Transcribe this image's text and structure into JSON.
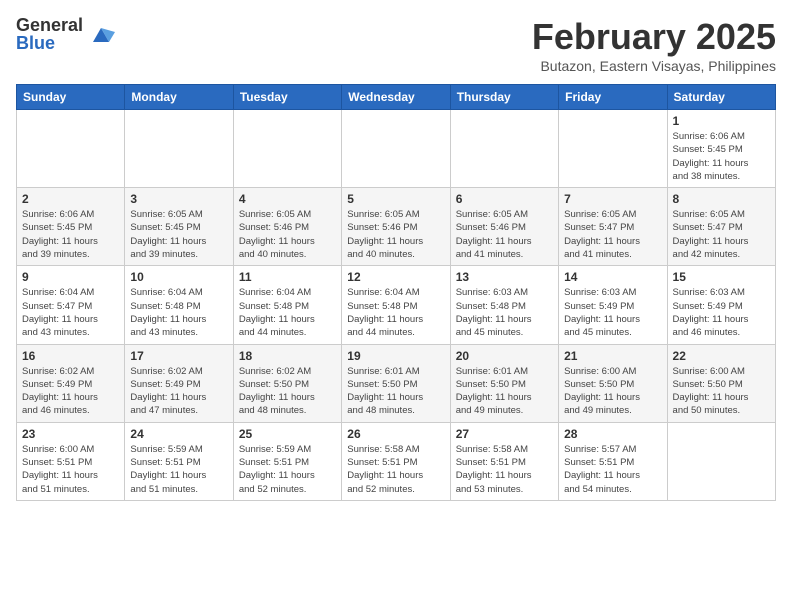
{
  "header": {
    "logo_general": "General",
    "logo_blue": "Blue",
    "month_year": "February 2025",
    "location": "Butazon, Eastern Visayas, Philippines"
  },
  "weekdays": [
    "Sunday",
    "Monday",
    "Tuesday",
    "Wednesday",
    "Thursday",
    "Friday",
    "Saturday"
  ],
  "weeks": [
    [
      {
        "day": "",
        "info": ""
      },
      {
        "day": "",
        "info": ""
      },
      {
        "day": "",
        "info": ""
      },
      {
        "day": "",
        "info": ""
      },
      {
        "day": "",
        "info": ""
      },
      {
        "day": "",
        "info": ""
      },
      {
        "day": "1",
        "info": "Sunrise: 6:06 AM\nSunset: 5:45 PM\nDaylight: 11 hours\nand 38 minutes."
      }
    ],
    [
      {
        "day": "2",
        "info": "Sunrise: 6:06 AM\nSunset: 5:45 PM\nDaylight: 11 hours\nand 39 minutes."
      },
      {
        "day": "3",
        "info": "Sunrise: 6:05 AM\nSunset: 5:45 PM\nDaylight: 11 hours\nand 39 minutes."
      },
      {
        "day": "4",
        "info": "Sunrise: 6:05 AM\nSunset: 5:46 PM\nDaylight: 11 hours\nand 40 minutes."
      },
      {
        "day": "5",
        "info": "Sunrise: 6:05 AM\nSunset: 5:46 PM\nDaylight: 11 hours\nand 40 minutes."
      },
      {
        "day": "6",
        "info": "Sunrise: 6:05 AM\nSunset: 5:46 PM\nDaylight: 11 hours\nand 41 minutes."
      },
      {
        "day": "7",
        "info": "Sunrise: 6:05 AM\nSunset: 5:47 PM\nDaylight: 11 hours\nand 41 minutes."
      },
      {
        "day": "8",
        "info": "Sunrise: 6:05 AM\nSunset: 5:47 PM\nDaylight: 11 hours\nand 42 minutes."
      }
    ],
    [
      {
        "day": "9",
        "info": "Sunrise: 6:04 AM\nSunset: 5:47 PM\nDaylight: 11 hours\nand 43 minutes."
      },
      {
        "day": "10",
        "info": "Sunrise: 6:04 AM\nSunset: 5:48 PM\nDaylight: 11 hours\nand 43 minutes."
      },
      {
        "day": "11",
        "info": "Sunrise: 6:04 AM\nSunset: 5:48 PM\nDaylight: 11 hours\nand 44 minutes."
      },
      {
        "day": "12",
        "info": "Sunrise: 6:04 AM\nSunset: 5:48 PM\nDaylight: 11 hours\nand 44 minutes."
      },
      {
        "day": "13",
        "info": "Sunrise: 6:03 AM\nSunset: 5:48 PM\nDaylight: 11 hours\nand 45 minutes."
      },
      {
        "day": "14",
        "info": "Sunrise: 6:03 AM\nSunset: 5:49 PM\nDaylight: 11 hours\nand 45 minutes."
      },
      {
        "day": "15",
        "info": "Sunrise: 6:03 AM\nSunset: 5:49 PM\nDaylight: 11 hours\nand 46 minutes."
      }
    ],
    [
      {
        "day": "16",
        "info": "Sunrise: 6:02 AM\nSunset: 5:49 PM\nDaylight: 11 hours\nand 46 minutes."
      },
      {
        "day": "17",
        "info": "Sunrise: 6:02 AM\nSunset: 5:49 PM\nDaylight: 11 hours\nand 47 minutes."
      },
      {
        "day": "18",
        "info": "Sunrise: 6:02 AM\nSunset: 5:50 PM\nDaylight: 11 hours\nand 48 minutes."
      },
      {
        "day": "19",
        "info": "Sunrise: 6:01 AM\nSunset: 5:50 PM\nDaylight: 11 hours\nand 48 minutes."
      },
      {
        "day": "20",
        "info": "Sunrise: 6:01 AM\nSunset: 5:50 PM\nDaylight: 11 hours\nand 49 minutes."
      },
      {
        "day": "21",
        "info": "Sunrise: 6:00 AM\nSunset: 5:50 PM\nDaylight: 11 hours\nand 49 minutes."
      },
      {
        "day": "22",
        "info": "Sunrise: 6:00 AM\nSunset: 5:50 PM\nDaylight: 11 hours\nand 50 minutes."
      }
    ],
    [
      {
        "day": "23",
        "info": "Sunrise: 6:00 AM\nSunset: 5:51 PM\nDaylight: 11 hours\nand 51 minutes."
      },
      {
        "day": "24",
        "info": "Sunrise: 5:59 AM\nSunset: 5:51 PM\nDaylight: 11 hours\nand 51 minutes."
      },
      {
        "day": "25",
        "info": "Sunrise: 5:59 AM\nSunset: 5:51 PM\nDaylight: 11 hours\nand 52 minutes."
      },
      {
        "day": "26",
        "info": "Sunrise: 5:58 AM\nSunset: 5:51 PM\nDaylight: 11 hours\nand 52 minutes."
      },
      {
        "day": "27",
        "info": "Sunrise: 5:58 AM\nSunset: 5:51 PM\nDaylight: 11 hours\nand 53 minutes."
      },
      {
        "day": "28",
        "info": "Sunrise: 5:57 AM\nSunset: 5:51 PM\nDaylight: 11 hours\nand 54 minutes."
      },
      {
        "day": "",
        "info": ""
      }
    ]
  ]
}
